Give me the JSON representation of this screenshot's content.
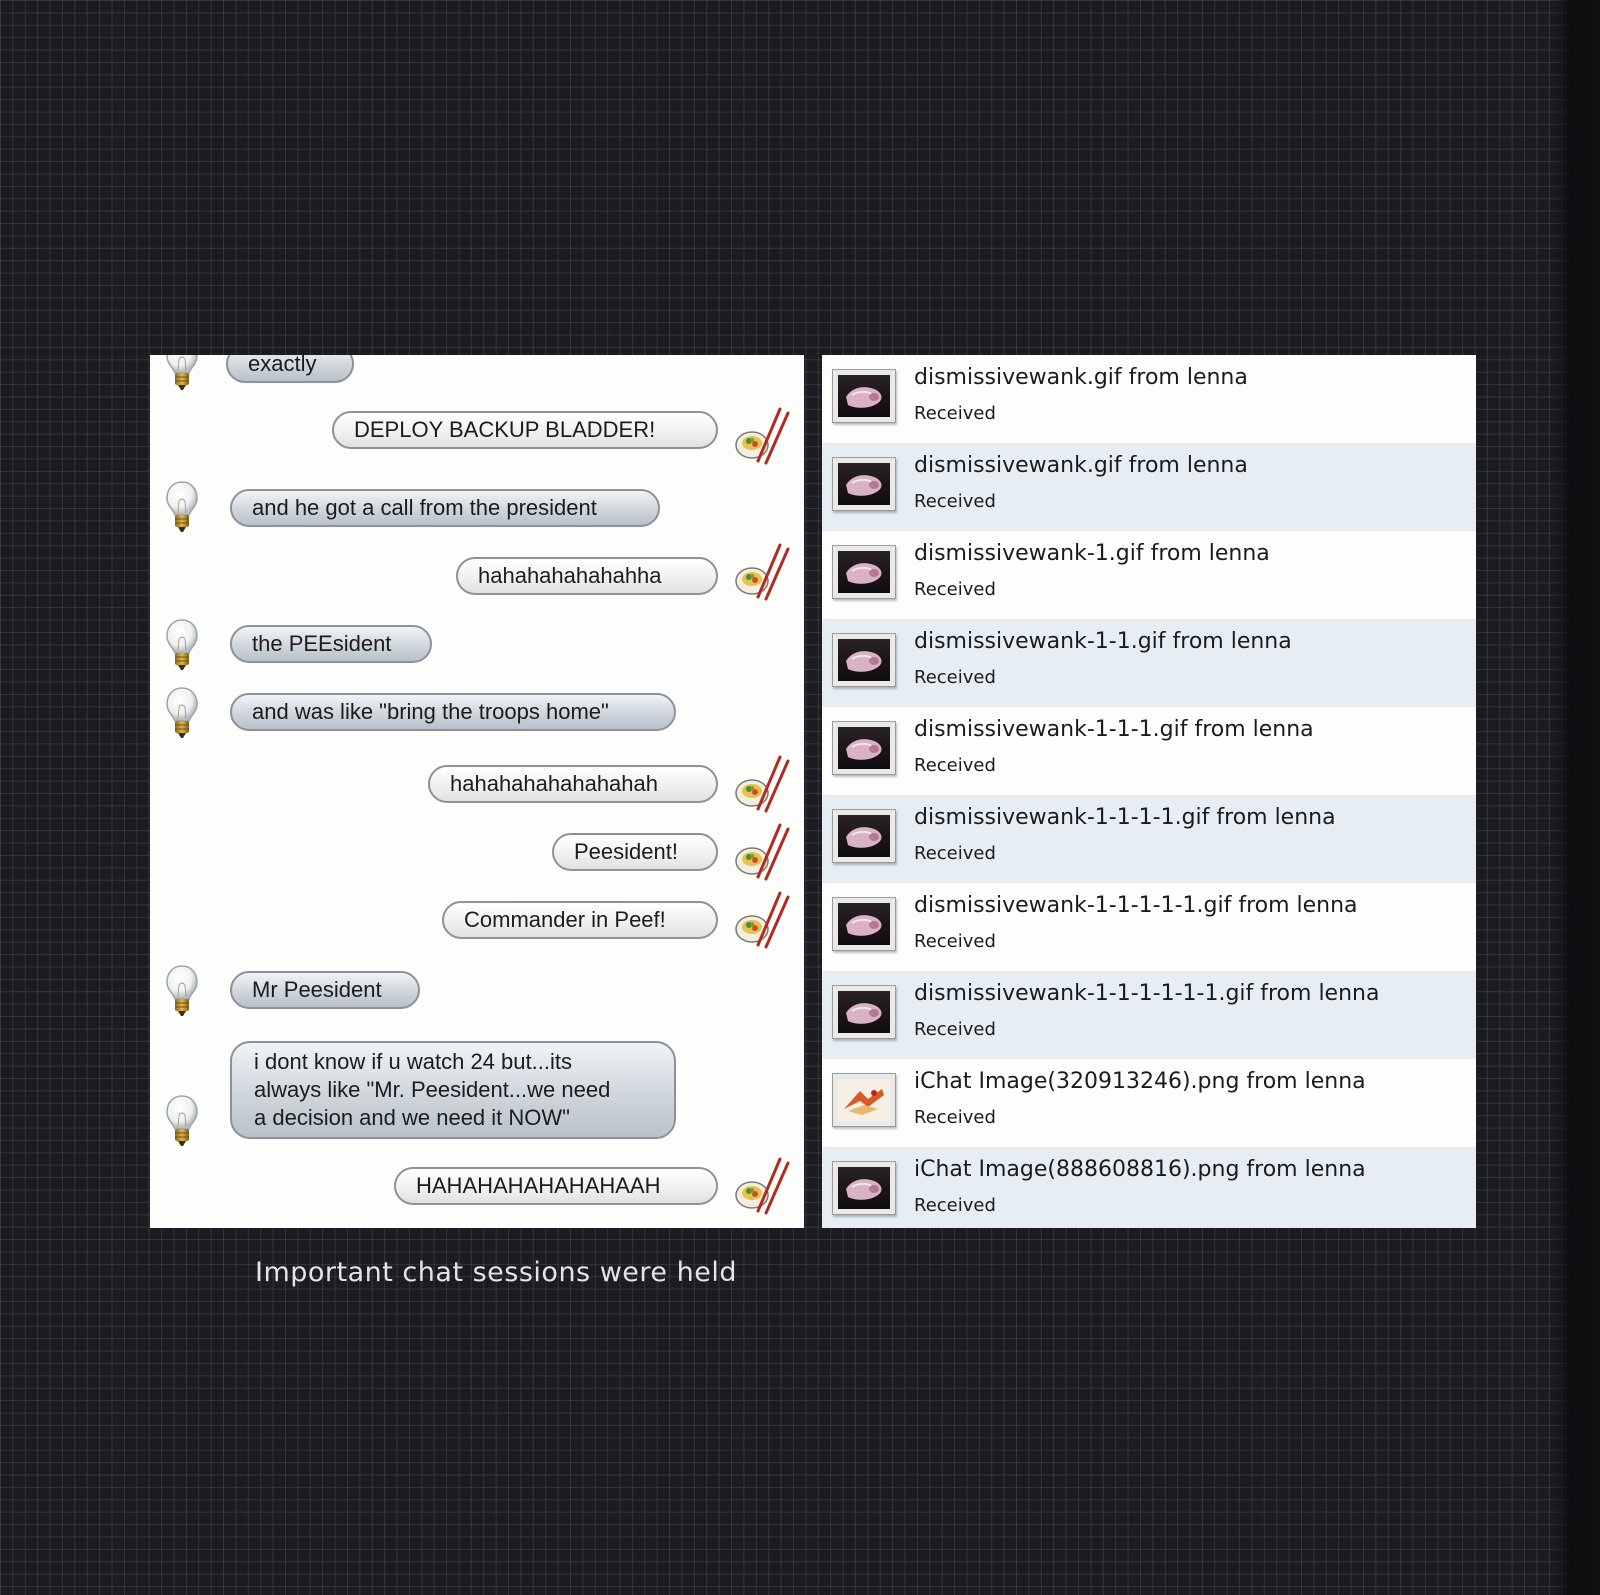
{
  "chat": {
    "messages": [
      {
        "from": "bulb",
        "text": "exactly"
      },
      {
        "from": "sushi",
        "text": "DEPLOY BACKUP BLADDER!"
      },
      {
        "from": "bulb",
        "text": "and he got a call from the president"
      },
      {
        "from": "sushi",
        "text": "hahahahahahahha"
      },
      {
        "from": "bulb",
        "text": "the PEEsident"
      },
      {
        "from": "bulb",
        "text": "and was like \"bring the troops home\""
      },
      {
        "from": "sushi",
        "text": "hahahahahahahahah"
      },
      {
        "from": "sushi",
        "text": "Peesident!"
      },
      {
        "from": "sushi",
        "text": "Commander in Peef!"
      },
      {
        "from": "bulb",
        "text": "Mr Peesident"
      },
      {
        "from": "bulb",
        "lines": [
          "i dont know if u watch 24 but...its",
          "always like \"Mr. Peesident...we need",
          "a decision and we need it NOW\""
        ]
      },
      {
        "from": "sushi",
        "text": "HAHAHAHAHAHAHAAH"
      }
    ],
    "icons": {
      "incoming": "lightbulb-icon",
      "outgoing": "sushi-chopsticks-icon"
    }
  },
  "file_transfers": {
    "items": [
      {
        "name": "dismissivewank.gif from lenna",
        "status": "Received",
        "thumb": "gif-thumbnail-icon"
      },
      {
        "name": "dismissivewank.gif from lenna",
        "status": "Received",
        "thumb": "gif-thumbnail-icon"
      },
      {
        "name": "dismissivewank-1.gif from lenna",
        "status": "Received",
        "thumb": "gif-thumbnail-icon"
      },
      {
        "name": "dismissivewank-1-1.gif from lenna",
        "status": "Received",
        "thumb": "gif-thumbnail-icon"
      },
      {
        "name": "dismissivewank-1-1-1.gif from lenna",
        "status": "Received",
        "thumb": "gif-thumbnail-icon"
      },
      {
        "name": "dismissivewank-1-1-1-1.gif from lenna",
        "status": "Received",
        "thumb": "gif-thumbnail-icon"
      },
      {
        "name": "dismissivewank-1-1-1-1-1.gif from lenna",
        "status": "Received",
        "thumb": "gif-thumbnail-icon"
      },
      {
        "name": "dismissivewank-1-1-1-1-1-1.gif from lenna",
        "status": "Received",
        "thumb": "gif-thumbnail-icon"
      },
      {
        "name": "iChat Image(320913246).png from lenna",
        "status": "Received",
        "thumb": "png-thumbnail-icon"
      },
      {
        "name": "iChat Image(888608816).png from lenna",
        "status": "Received",
        "thumb": "gif-thumbnail-icon"
      }
    ]
  },
  "caption": "Important chat sessions were held",
  "colors": {
    "background": "#1c1b20",
    "panel": "#fdfdfc",
    "alt_row": "#e6edf3",
    "incoming_bubble": "#c9d1d8",
    "outgoing_bubble": "#f2f3f2"
  }
}
